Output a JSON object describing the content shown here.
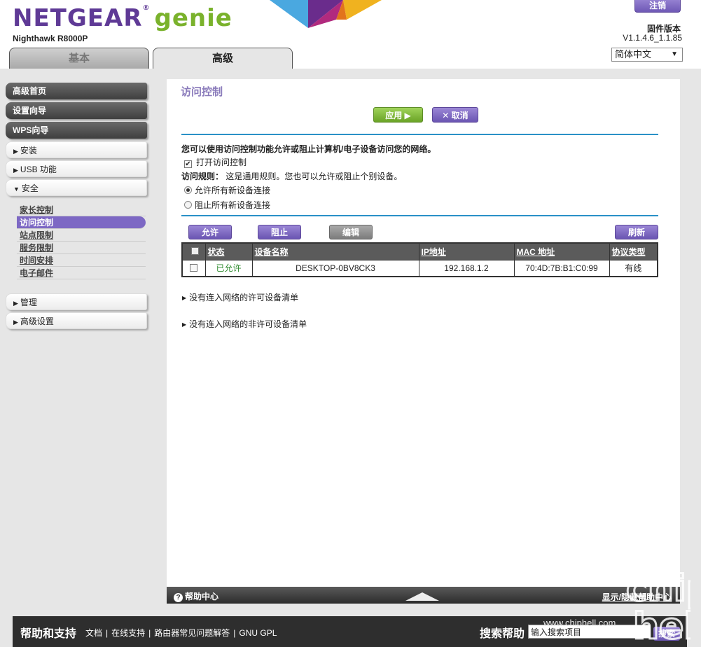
{
  "header": {
    "brand": "NETGEAR",
    "brand_suffix": "genie",
    "model": "Nighthawk R8000P",
    "logout_label": "注销",
    "firmware_label": "固件版本",
    "firmware_version": "V1.1.4.6_1.1.85",
    "language": "简体中文"
  },
  "tabs": {
    "basic": "基本",
    "advanced": "高级"
  },
  "sidebar": {
    "main": [
      "高级首页",
      "设置向导",
      "WPS向导"
    ],
    "install": "安装",
    "usb": "USB 功能",
    "security": "安全",
    "security_items": [
      "家长控制",
      "访问控制",
      "站点限制",
      "服务限制",
      "时间安排",
      "电子邮件"
    ],
    "manage": "管理",
    "advanced_settings": "高级设置"
  },
  "content": {
    "title": "访问控制",
    "apply": "应用 ▶",
    "cancel": "✕ 取消",
    "intro": "您可以使用访问控制功能允许或阻止计算机/电子设备访问您的网络。",
    "enable_label": "打开访问控制",
    "enable_checked": true,
    "rule_label": "访问规则：",
    "rule_text": "这是通用规则。您也可以允许或阻止个别设备。",
    "radio_allow": "允许所有新设备连接",
    "radio_block": "阻止所有新设备连接",
    "selected_rule": "allow",
    "btn_allow": "允许",
    "btn_block": "阻止",
    "btn_edit": "编辑",
    "btn_refresh": "刷新",
    "table": {
      "headers": [
        "状态",
        "设备名称",
        "IP地址",
        "MAC 地址",
        "协议类型"
      ],
      "rows": [
        {
          "status": "已允许",
          "name": "DESKTOP-0BV8CK3",
          "ip": "192.168.1.2",
          "mac": "70:4D:7B:B1:C0:99",
          "conn": "有线"
        }
      ]
    },
    "allowed_not_connected": "没有连入网络的许可设备清单",
    "blocked_not_connected": "没有连入网络的非许可设备清单"
  },
  "helpbar": {
    "help_center": "帮助中心",
    "toggle": "显示/隐藏帮助中心"
  },
  "footer": {
    "title": "帮助和支持",
    "links": [
      "文档",
      "在线支持",
      "路由器常见问题解答",
      "GNU GPL"
    ],
    "search_label": "搜索帮助",
    "search_placeholder": "输入搜索项目",
    "search_btn": "搜索"
  },
  "watermark": {
    "brand": "chip hell",
    "url": "www.chiphell.com"
  }
}
